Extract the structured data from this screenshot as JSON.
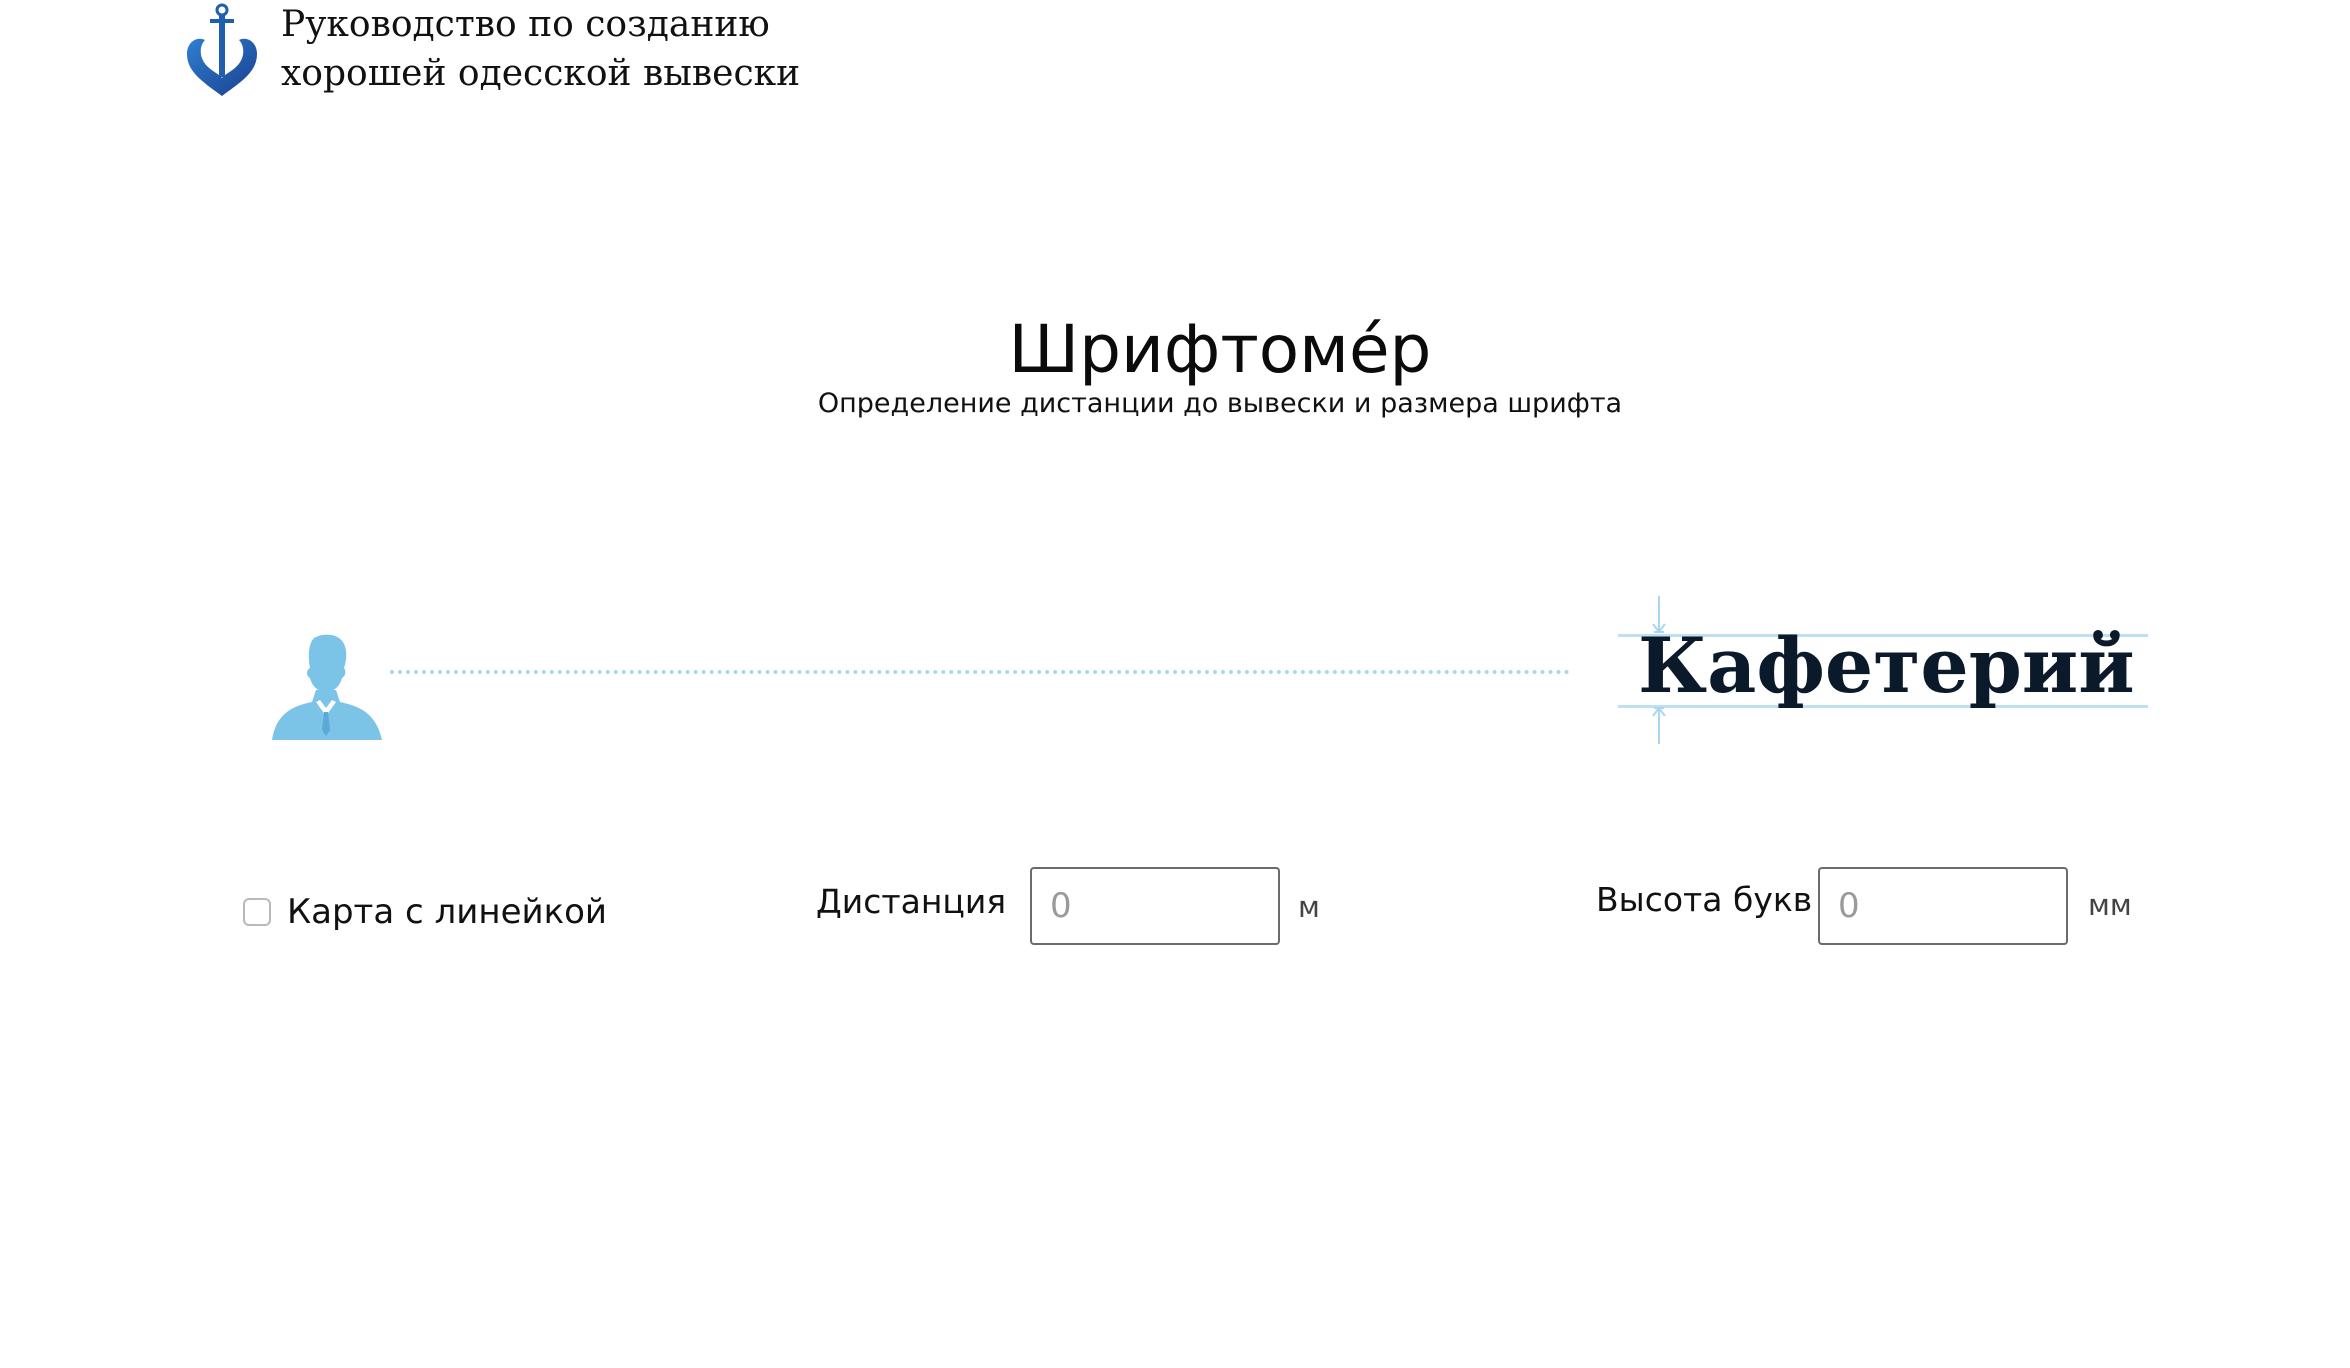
{
  "header": {
    "title_line1": "Руководство по созданию",
    "title_line2": "хорошей одесской вывески",
    "logo_icon": "anchor-heart-icon"
  },
  "main": {
    "title": "Шрифтоме́р",
    "subtitle": "Определение дистанции до вывески и размера шрифта"
  },
  "illustration": {
    "person_icon": "person-silhouette-icon",
    "sign_text": "Кафетерий"
  },
  "controls": {
    "card_ruler": {
      "label": "Карта с линейкой",
      "checked": false
    },
    "distance": {
      "label": "Дистанция",
      "placeholder": "0",
      "unit": "м"
    },
    "letter_height": {
      "label": "Высота букв",
      "placeholder": "0",
      "unit": "мм"
    }
  },
  "colors": {
    "brand_blue": "#1f5fae",
    "light_blue": "#7cc3e8",
    "guide_blue": "#bfe0f2"
  }
}
